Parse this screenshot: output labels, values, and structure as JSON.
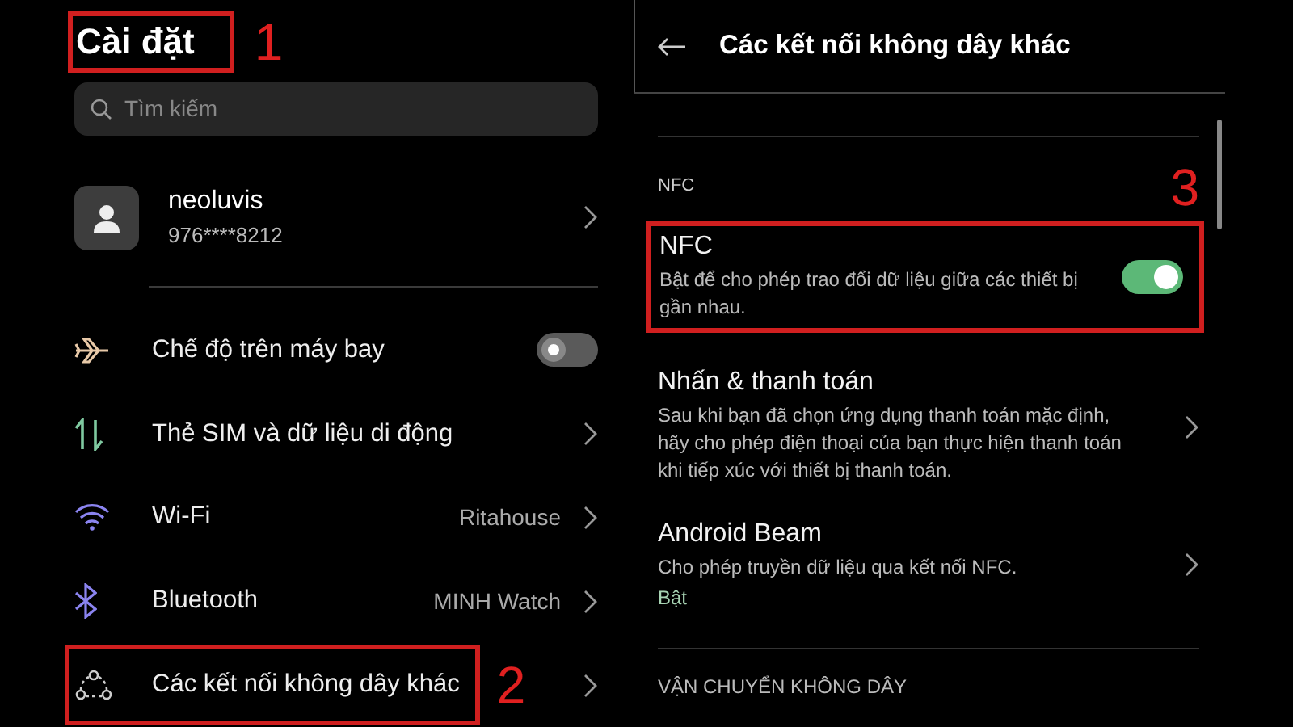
{
  "settings": {
    "title": "Cài đặt",
    "title_callout": "1",
    "search": {
      "placeholder": "Tìm kiếm"
    },
    "account": {
      "name": "neoluvis",
      "phone": "976****8212"
    },
    "items": [
      {
        "kind": "toggle",
        "label": "Chế độ trên máy bay",
        "on": false
      },
      {
        "kind": "link",
        "label": "Thẻ SIM và dữ liệu di động"
      },
      {
        "kind": "link",
        "label": "Wi-Fi",
        "value": "Ritahouse"
      },
      {
        "kind": "link",
        "label": "Bluetooth",
        "value": "MINH Watch"
      },
      {
        "kind": "link",
        "label": "Các kết nối không dây khác",
        "callout": "2"
      }
    ]
  },
  "detail": {
    "title": "Các kết nối không dây khác",
    "section": "NFC",
    "items": [
      {
        "kind": "toggle",
        "title": "NFC",
        "description": "Bật để cho phép trao đổi dữ liệu giữa các thiết bị gần nhau.",
        "on": true,
        "callout": "3"
      },
      {
        "kind": "link",
        "title": "Nhấn & thanh toán",
        "description": "Sau khi bạn đã chọn ứng dụng thanh toán mặc định, hãy cho phép điện thoại của bạn thực hiện thanh toán khi tiếp xúc với thiết bị thanh toán."
      },
      {
        "kind": "link",
        "title": "Android Beam",
        "description": "Cho phép truyền dữ liệu qua kết nối NFC.",
        "status": "Bật"
      }
    ],
    "next_section": "VẬN CHUYỂN KHÔNG DÂY"
  }
}
